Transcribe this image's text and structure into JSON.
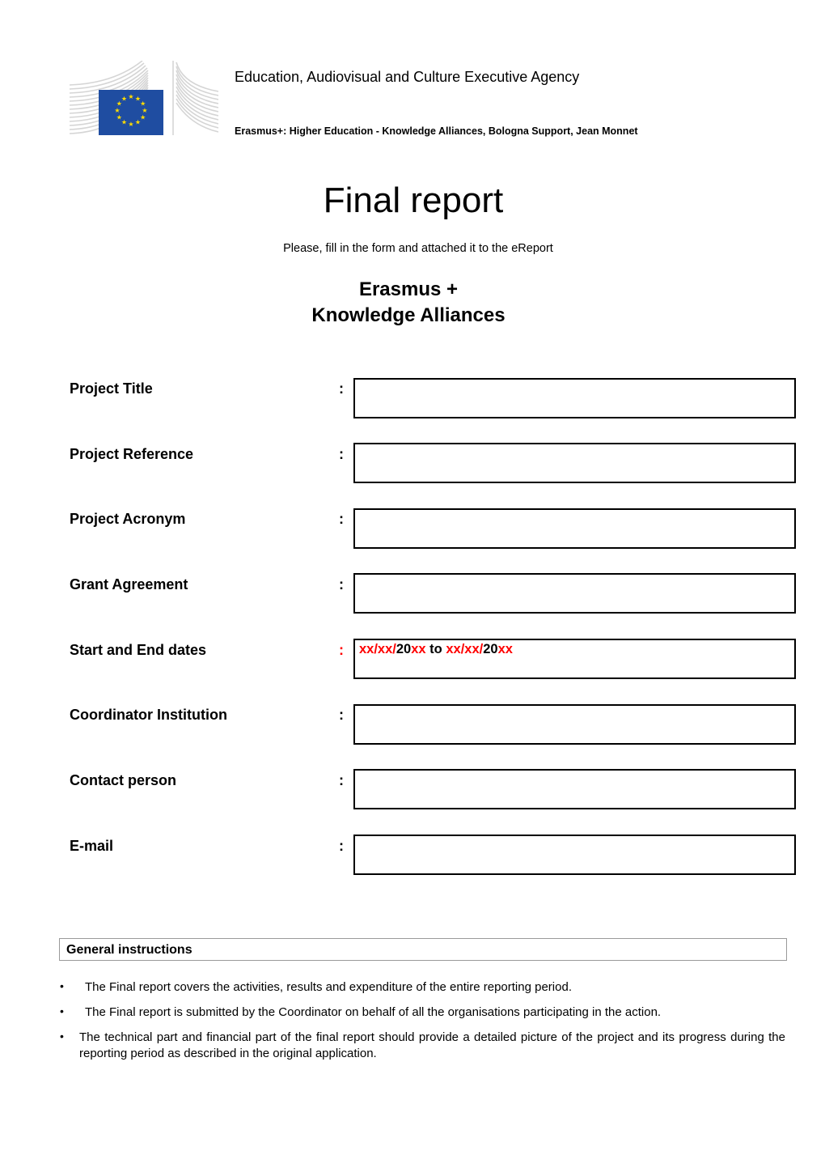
{
  "header": {
    "logo_icon": "european-commission-logo",
    "flag_color": "#1f4da1",
    "star_color": "#ffdd00",
    "agency": "Education, Audiovisual and Culture Executive Agency",
    "programme": "Erasmus+: Higher Education - Knowledge Alliances, Bologna Support, Jean Monnet"
  },
  "document": {
    "title": "Final report",
    "subtitle": "Please, fill in the form and attached it to the eReport",
    "heading_line1": "Erasmus +",
    "heading_line2": "Knowledge Alliances"
  },
  "form": {
    "colon": ":",
    "fields": [
      {
        "label": "Project Title",
        "value": ""
      },
      {
        "label": "Project Reference",
        "value": ""
      },
      {
        "label": "Project Acronym",
        "value": ""
      },
      {
        "label": "Grant Agreement",
        "value": ""
      },
      {
        "label": "Start and End dates",
        "value": "xx/xx/20xx to xx/xx/20xx"
      },
      {
        "label": "Coordinator Institution",
        "value": ""
      },
      {
        "label": "Contact person",
        "value": ""
      },
      {
        "label": "E-mail",
        "value": ""
      }
    ],
    "dates_parts": {
      "start_dd_mm": "xx/xx/",
      "start_century": "20",
      "start_yy": "xx",
      "separator": " to ",
      "end_dd_mm": "xx/xx/",
      "end_century": "20",
      "end_yy": "xx"
    },
    "placeholder_color": "#ff0000"
  },
  "instructions": {
    "title": "General instructions",
    "bullet": "•",
    "items": [
      "The Final report covers the activities, results and expenditure of the entire reporting period.",
      "The Final report is submitted by the Coordinator on behalf of all the organisations participating in the action.",
      "The technical part and financial part of the final report should provide a detailed picture of the project and its progress during the reporting period as described in the original application."
    ]
  }
}
